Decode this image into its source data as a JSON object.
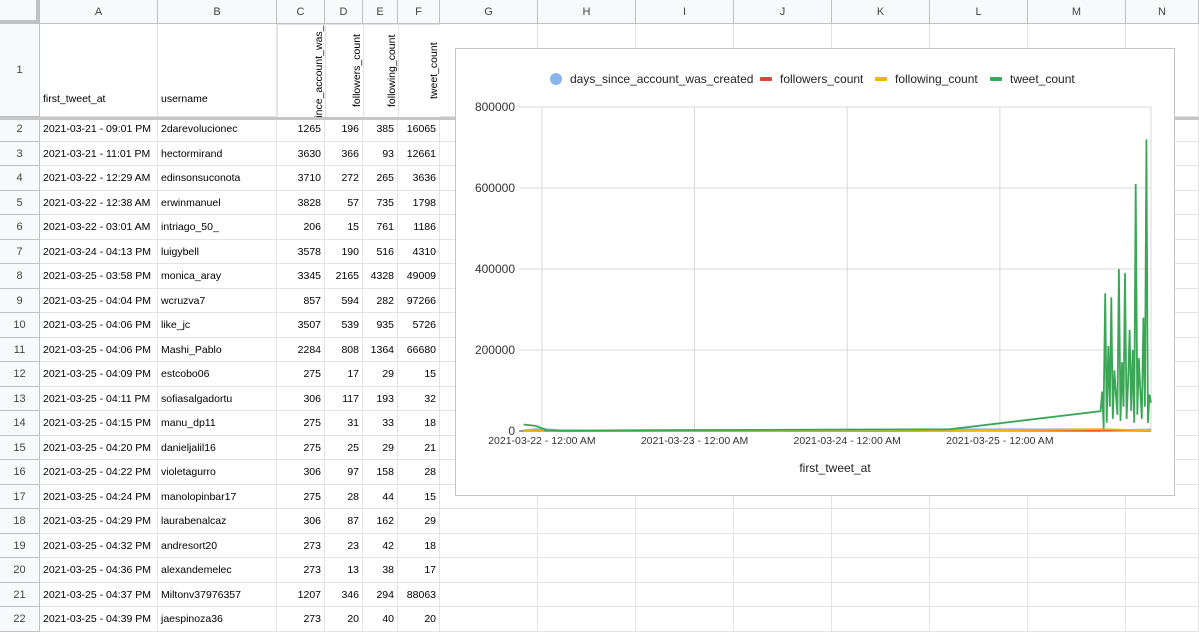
{
  "columns": [
    "A",
    "B",
    "C",
    "D",
    "E",
    "F",
    "G",
    "H",
    "I",
    "J",
    "K",
    "L",
    "M",
    "N"
  ],
  "headers": {
    "first_tweet_at": "first_tweet_at",
    "username": "username",
    "days": "days_since_account_was_created",
    "followers": "followers_count",
    "following": "following_count",
    "tweets": "tweet_count"
  },
  "rows": [
    {
      "n": "2",
      "date": "2021-03-21 - 09:01 PM",
      "user": "2darevolucionec",
      "days": "1265",
      "followers": "196",
      "following": "385",
      "tweets": "16065"
    },
    {
      "n": "3",
      "date": "2021-03-21 - 11:01 PM",
      "user": "hectormirand",
      "days": "3630",
      "followers": "366",
      "following": "93",
      "tweets": "12661"
    },
    {
      "n": "4",
      "date": "2021-03-22 - 12:29 AM",
      "user": "edinsonsuconota",
      "days": "3710",
      "followers": "272",
      "following": "265",
      "tweets": "3636"
    },
    {
      "n": "5",
      "date": "2021-03-22 - 12:38 AM",
      "user": "erwinmanuel",
      "days": "3828",
      "followers": "57",
      "following": "735",
      "tweets": "1798"
    },
    {
      "n": "6",
      "date": "2021-03-22 - 03:01 AM",
      "user": "intriago_50_",
      "days": "206",
      "followers": "15",
      "following": "761",
      "tweets": "1186"
    },
    {
      "n": "7",
      "date": "2021-03-24 - 04:13 PM",
      "user": "luigybell",
      "days": "3578",
      "followers": "190",
      "following": "516",
      "tweets": "4310"
    },
    {
      "n": "8",
      "date": "2021-03-25 - 03:58 PM",
      "user": "monica_aray",
      "days": "3345",
      "followers": "2165",
      "following": "4328",
      "tweets": "49009"
    },
    {
      "n": "9",
      "date": "2021-03-25 - 04:04 PM",
      "user": "wcruzva7",
      "days": "857",
      "followers": "594",
      "following": "282",
      "tweets": "97266"
    },
    {
      "n": "10",
      "date": "2021-03-25 - 04:06 PM",
      "user": "like_jc",
      "days": "3507",
      "followers": "539",
      "following": "935",
      "tweets": "5726"
    },
    {
      "n": "11",
      "date": "2021-03-25 - 04:06 PM",
      "user": "Mashi_Pablo",
      "days": "2284",
      "followers": "808",
      "following": "1364",
      "tweets": "66680"
    },
    {
      "n": "12",
      "date": "2021-03-25 - 04:09 PM",
      "user": "estcobo06",
      "days": "275",
      "followers": "17",
      "following": "29",
      "tweets": "15"
    },
    {
      "n": "13",
      "date": "2021-03-25 - 04:11 PM",
      "user": "sofiasalgadortu",
      "days": "306",
      "followers": "117",
      "following": "193",
      "tweets": "32"
    },
    {
      "n": "14",
      "date": "2021-03-25 - 04:15 PM",
      "user": "manu_dp11",
      "days": "275",
      "followers": "31",
      "following": "33",
      "tweets": "18"
    },
    {
      "n": "15",
      "date": "2021-03-25 - 04:20 PM",
      "user": "danieljalil16",
      "days": "275",
      "followers": "25",
      "following": "29",
      "tweets": "21"
    },
    {
      "n": "16",
      "date": "2021-03-25 - 04:22 PM",
      "user": "violetagurro",
      "days": "306",
      "followers": "97",
      "following": "158",
      "tweets": "28"
    },
    {
      "n": "17",
      "date": "2021-03-25 - 04:24 PM",
      "user": "manolopinbar17",
      "days": "275",
      "followers": "28",
      "following": "44",
      "tweets": "15"
    },
    {
      "n": "18",
      "date": "2021-03-25 - 04:29 PM",
      "user": "laurabenalcaz",
      "days": "306",
      "followers": "87",
      "following": "162",
      "tweets": "29"
    },
    {
      "n": "19",
      "date": "2021-03-25 - 04:32 PM",
      "user": "andresort20",
      "days": "273",
      "followers": "23",
      "following": "42",
      "tweets": "18"
    },
    {
      "n": "20",
      "date": "2021-03-25 - 04:36 PM",
      "user": "alexandemelec",
      "days": "273",
      "followers": "13",
      "following": "38",
      "tweets": "17"
    },
    {
      "n": "21",
      "date": "2021-03-25 - 04:37 PM",
      "user": "Miltonv37976357",
      "days": "1207",
      "followers": "346",
      "following": "294",
      "tweets": "88063"
    },
    {
      "n": "22",
      "date": "2021-03-25 - 04:39 PM",
      "user": "jaespinoza36",
      "days": "273",
      "followers": "20",
      "following": "40",
      "tweets": "20"
    }
  ],
  "header_row_number": "1",
  "chart_data": {
    "type": "line",
    "title": "",
    "xlabel": "first_tweet_at",
    "ylabel": "",
    "ylim": [
      0,
      800000
    ],
    "yticks": [
      "0",
      "200000",
      "400000",
      "600000",
      "800000"
    ],
    "xticks": [
      "2021-03-22 - 12:00 AM",
      "2021-03-23 - 12:00 AM",
      "2021-03-24 - 12:00 AM",
      "2021-03-25 - 12:00 AM"
    ],
    "xtick_values": [
      1,
      2,
      3,
      4
    ],
    "xlim": [
      0.85,
      4.99
    ],
    "legend_position": "top",
    "grid": true,
    "series": [
      {
        "name": "days_since_account_was_created",
        "color": "#8ab4f0",
        "marker": "circle",
        "x": [
          0.88,
          0.96,
          1.02,
          1.02,
          1.13,
          3.67,
          4.66,
          4.67,
          4.99
        ],
        "y": [
          1265,
          3630,
          3710,
          3828,
          206,
          3578,
          3345,
          857,
          3000
        ]
      },
      {
        "name": "followers_count",
        "color": "#db4437",
        "marker": "line",
        "x": [
          0.88,
          0.96,
          1.02,
          1.13,
          3.67,
          4.66,
          4.99
        ],
        "y": [
          196,
          366,
          272,
          15,
          190,
          2165,
          600
        ]
      },
      {
        "name": "following_count",
        "color": "#f4b400",
        "marker": "line",
        "x": [
          0.88,
          0.96,
          1.02,
          1.13,
          3.67,
          4.66,
          4.99
        ],
        "y": [
          385,
          93,
          265,
          761,
          516,
          4328,
          1500
        ]
      },
      {
        "name": "tweet_count",
        "color": "#3aa757",
        "marker": "line",
        "x": [
          0.88,
          0.96,
          1.02,
          1.02,
          1.13,
          3.67,
          4.66,
          4.67,
          4.68,
          4.68,
          4.69,
          4.7,
          4.71,
          4.72,
          4.73,
          4.74,
          4.75,
          4.76,
          4.77,
          4.78,
          4.79,
          4.8,
          4.81,
          4.82,
          4.83,
          4.84,
          4.85,
          4.86,
          4.87,
          4.88,
          4.89,
          4.9,
          4.91,
          4.92,
          4.93,
          4.94,
          4.95,
          4.96,
          4.97,
          4.98,
          4.99
        ],
        "y": [
          16065,
          12661,
          3636,
          1798,
          1186,
          4310,
          49009,
          97266,
          5726,
          66680,
          340000,
          20000,
          210000,
          60000,
          330000,
          30000,
          150000,
          90000,
          40000,
          400000,
          25000,
          170000,
          60000,
          390000,
          30000,
          120000,
          250000,
          50000,
          200000,
          20000,
          610000,
          40000,
          180000,
          100000,
          30000,
          280000,
          60000,
          720000,
          20000,
          90000,
          70000
        ]
      }
    ]
  }
}
